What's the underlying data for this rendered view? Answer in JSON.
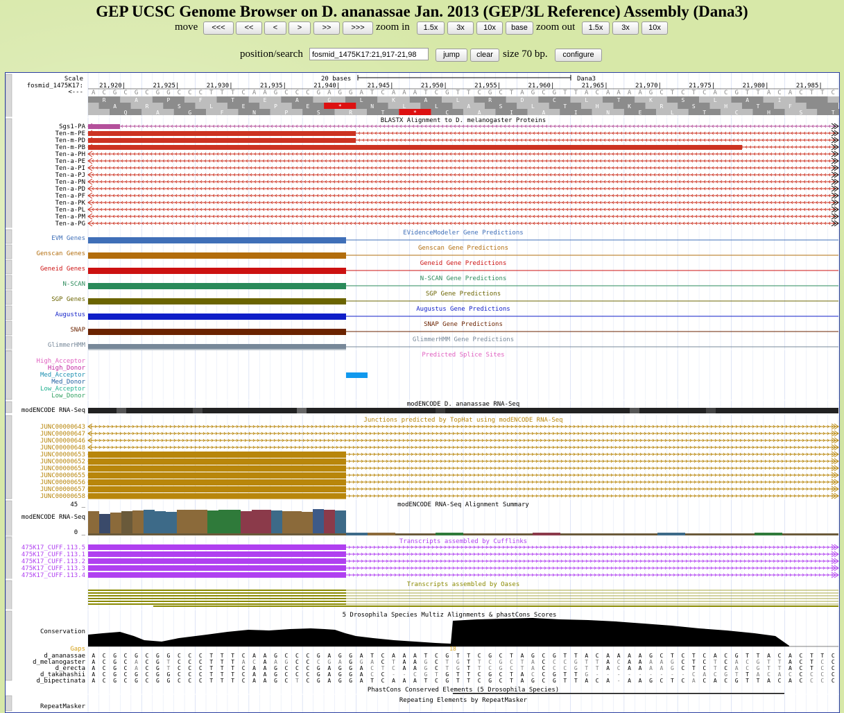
{
  "header": {
    "title": "GEP UCSC Genome Browser on D. ananassae Jan. 2013 (GEP/3L Reference) Assembly (Dana3)",
    "move_label": "move",
    "move_buttons": [
      "<<<",
      "<<",
      "<",
      ">",
      ">>",
      ">>>"
    ],
    "zoom_in_label": "zoom in",
    "zoom_in_buttons": [
      "1.5x",
      "3x",
      "10x",
      "base"
    ],
    "zoom_out_label": "zoom out",
    "zoom_out_buttons": [
      "1.5x",
      "3x",
      "10x"
    ]
  },
  "position": {
    "label": "position/search",
    "value": "fosmid_1475K17:21,917-21,98",
    "jump_label": "jump",
    "clear_label": "clear",
    "size_text": "size 70 bp.",
    "configure_label": "configure"
  },
  "ruler": {
    "scale_label": "Scale",
    "scale_bases": "20 bases",
    "assembly": "Dana3",
    "chrom_label": "fosmid_1475K17:",
    "strand_label": "<---",
    "ticks": [
      "21,920|",
      "21,925|",
      "21,930|",
      "21,935|",
      "21,940|",
      "21,945|",
      "21,950|",
      "21,955|",
      "21,960|",
      "21,965|",
      "21,970|",
      "21,975|",
      "21,980|",
      "21,985|"
    ],
    "dna": "ACGCGCGGCCCTTTCAAGCCCGAGGATCAAATCGTTCGCTAGCGTTACAAAAGCTCTCACGTTACACTTC",
    "frame1": [
      "",
      "R",
      "",
      "A",
      "",
      "P",
      "",
      "F",
      "",
      "T",
      "",
      "E",
      "",
      "A",
      "",
      "G",
      "",
      "L",
      "",
      "K",
      "",
      "A",
      "",
      "L",
      "",
      "R",
      "",
      "D",
      "",
      "C",
      "",
      "L",
      "",
      "T",
      "",
      "K",
      "",
      "S",
      "",
      "L",
      "",
      "A",
      "",
      "I",
      ""
    ],
    "frame2": [
      "",
      "A",
      "",
      "R",
      "",
      "S",
      "",
      "L",
      "",
      "E",
      "",
      "P",
      "",
      "E",
      "",
      "*",
      "",
      "N",
      "",
      "L",
      "",
      "L",
      "",
      "A",
      "",
      "S",
      "",
      "L",
      "",
      "T",
      "",
      "H",
      "",
      "K",
      "",
      "R",
      "",
      "S",
      "",
      "H",
      "",
      "T",
      "",
      "F"
    ],
    "frame3": [
      "",
      "Q",
      "",
      "A",
      "",
      "G",
      "",
      "F",
      "",
      "N",
      "",
      "P",
      "",
      "S",
      "",
      "R",
      "",
      "T",
      "",
      "*",
      "",
      "C",
      "",
      "A",
      "",
      "I",
      "",
      "A",
      "",
      "I",
      "",
      "N",
      "",
      "E",
      "",
      "L",
      "",
      "T",
      "",
      "C",
      "",
      "H",
      "",
      "S",
      "",
      "T"
    ]
  },
  "tracks": {
    "blastx": {
      "title": "BLASTX Alignment to D. melanogaster Proteins",
      "rows": [
        "Sgs1-PA",
        "Ten-m-PE",
        "Ten-m-PD",
        "Ten-m-PB",
        "Ten-a-PH",
        "Ten-a-PE",
        "Ten-a-PI",
        "Ten-a-PJ",
        "Ten-a-PN",
        "Ten-a-PD",
        "Ten-a-PF",
        "Ten-a-PK",
        "Ten-a-PL",
        "Ten-a-PM",
        "Ten-a-PG"
      ],
      "colors": [
        "#b4509b",
        "#cc3322"
      ]
    },
    "gene_predictions": [
      {
        "label": "EVM Genes",
        "title": "EVidenceModeler Gene Predictions",
        "color": "#3f6fb8"
      },
      {
        "label": "Genscan Genes",
        "title": "Genscan Gene Predictions",
        "color": "#b26d0d"
      },
      {
        "label": "Geneid Genes",
        "title": "Geneid Gene Predictions",
        "color": "#cc1111"
      },
      {
        "label": "N-SCAN",
        "title": "N-SCAN Gene Predictions",
        "color": "#2a8a5a"
      },
      {
        "label": "SGP Genes",
        "title": "SGP Gene Predictions",
        "color": "#6b6400"
      },
      {
        "label": "Augustus",
        "title": "Augustus Gene Predictions",
        "color": "#0f1ec8"
      },
      {
        "label": "SNAP",
        "title": "SNAP Gene Predictions",
        "color": "#6b2300"
      },
      {
        "label": "GlimmerHMM",
        "title": "GlimmerHMM Gene Predictions",
        "color": "#778899"
      }
    ],
    "splice": {
      "title": "Predicted Splice Sites",
      "title_color": "#e060c0",
      "rows": [
        {
          "label": "High_Acceptor",
          "color": "#e060c0"
        },
        {
          "label": "High_Donor",
          "color": "#c020a0"
        },
        {
          "label": "Med_Acceptor",
          "color": "#1a8fb0"
        },
        {
          "label": "Med_Donor",
          "color": "#2060a0"
        },
        {
          "label": "Low_Acceptor",
          "color": "#20b090"
        },
        {
          "label": "Low_Donor",
          "color": "#30a060"
        }
      ],
      "marker_color": "#1199ee"
    },
    "rnaseq": {
      "title": "modENCODE D. ananassae RNA-Seq",
      "label": "modENCODE RNA-Seq"
    },
    "junctions": {
      "title": "Junctions predicted by TopHat using modENCODE RNA-Seq",
      "rows": [
        "JUNC00000643",
        "JUNC00000647",
        "JUNC00000646",
        "JUNC00000648",
        "JUNC00000653",
        "JUNC00000652",
        "JUNC00000654",
        "JUNC00000655",
        "JUNC00000656",
        "JUNC00000657",
        "JUNC00000658"
      ],
      "color": "#b8860b"
    },
    "summary": {
      "title": "modENCODE RNA-Seq Alignment Summary",
      "label": "modENCODE RNA-Seq",
      "max": "45 _",
      "min": "0 _"
    },
    "cufflinks": {
      "title": "Transcripts assembled by Cufflinks",
      "rows": [
        "475K17_CUFF.113.5",
        "475K17_CUFF.113.1",
        "475K17_CUFF.113.2",
        "475K17_CUFF.113.3",
        "475K17_CUFF.113.4"
      ],
      "color": "#b040f0"
    },
    "oases": {
      "title": "Transcripts assembled by Oases",
      "color": "#8a8a00"
    },
    "multiz": {
      "title": "5 Drosophila Species Multiz Alignments & phastCons Scores",
      "conservation_label": "Conservation",
      "gaps_label": "Gaps",
      "gap_number": "18",
      "species": [
        {
          "name": "d_ananassae",
          "seq": "ACGCGCGGCCCTTTCAAGCCCGAGGATCAAATCGTTCGCTAGCGTTACAAAAGCTCTCACGTTACACTTC"
        },
        {
          "name": "d_melanogaster",
          "seq": "ACGCACGTCCCTTTACAAGCCCGAGGACTAAGCTGTTCGCTACCCGTTACAAAAGCTCTCACGTTACTCCCC"
        },
        {
          "name": "d_erecta",
          "seq": "ACGCACGTCCCTTTCAAGCCCGAGGACTCAAGCTGTTCGCTACCCGTTACAAAAGCTCTCACGTTACTCCCC"
        },
        {
          "name": "d_takahashii",
          "seq": "ACGCGCGGCCCTTTCAAGCCCGAGGACC--CGTGTTCGCTACCGTTG---------CACGTTACACCCCC"
        },
        {
          "name": "d_bipectinata",
          "seq": "ACGCGCGGCCCTTTCAAGCTCGAGGATCAAATCGTTCGCTAGCGTTACA-AAGCTCACACGTTACACCCC"
        }
      ]
    },
    "phastcons": {
      "title": "PhastCons Conserved Elements (5 Drosophila Species)"
    },
    "repeatmasker": {
      "title": "Repeating Elements by RepeatMasker",
      "label": "RepeatMasker"
    }
  }
}
